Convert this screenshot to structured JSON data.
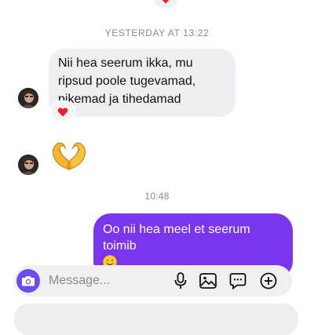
{
  "thread": {
    "timestamp_1": "YESTERDAY AT 13:22",
    "incoming_message": "Nii hea seerum ikka, mu ripsud poole tugevamad, pikemad ja tihedamad",
    "incoming_reaction": "heart-icon",
    "incoming_emoji": "heart-hands-emoji",
    "timestamp_2": "10:48",
    "outgoing_message": "Oo nii hea meel et seerum toimib"
  },
  "composer": {
    "placeholder": "Message..."
  },
  "icons": {
    "camera": "camera-icon",
    "mic": "microphone-icon",
    "gallery": "image-icon",
    "sticker": "sticker-icon",
    "add": "plus-circle-icon"
  },
  "colors": {
    "outgoing_bubble": "#7a35ee",
    "incoming_bubble": "#efeff2",
    "camera_button": "#6c4bf4",
    "reaction_heart": "#e8202a"
  }
}
